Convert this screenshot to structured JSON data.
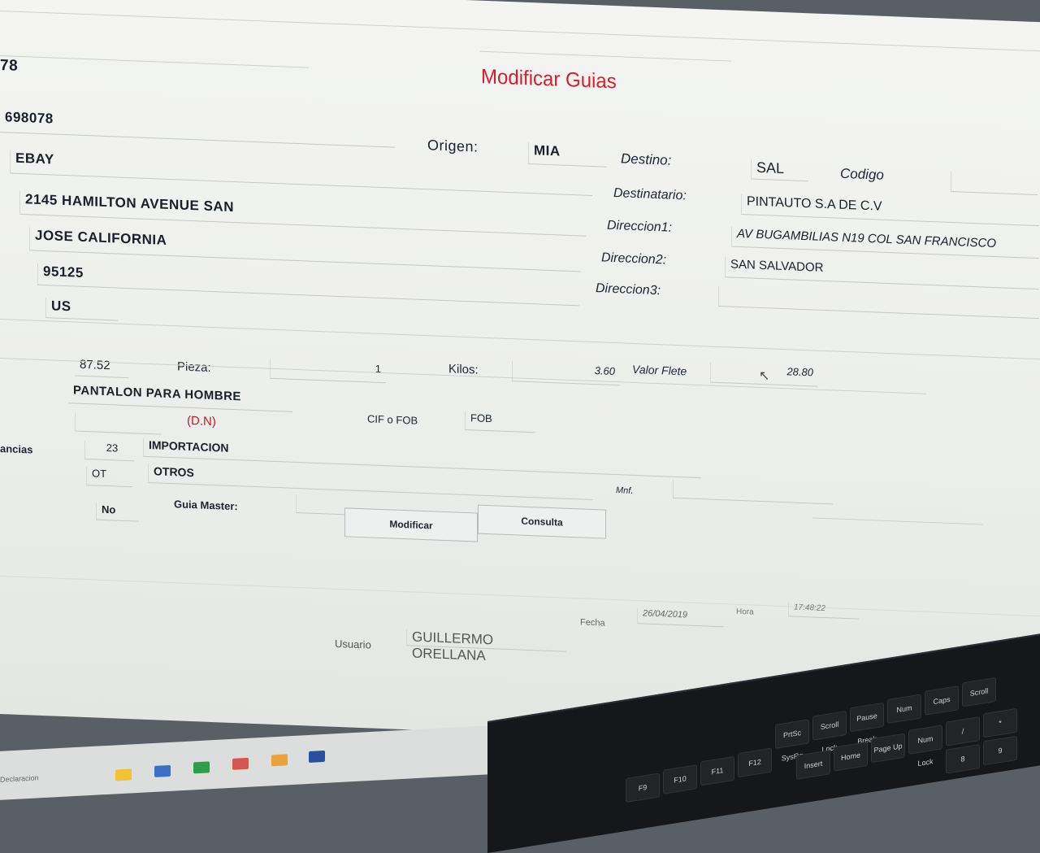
{
  "window": {
    "title": "Modificar Guias"
  },
  "header_left": {
    "fragment": "78",
    "guia_number": "698078"
  },
  "shipper": {
    "name": "EBAY",
    "address1": "2145 HAMILTON AVENUE SAN",
    "address2": "JOSE CALIFORNIA",
    "zip": "95125",
    "country": "US"
  },
  "route": {
    "origen_label": "Origen:",
    "origen_value": "MIA",
    "destino_label": "Destino:",
    "destino_value": "SAL",
    "codigo_label": "Codigo",
    "codigo_value": ""
  },
  "consignee": {
    "destinatario_label": "Destinatario:",
    "destinatario_value": "PINTAUTO S.A DE C.V",
    "direccion1_label": "Direccion1:",
    "direccion1_value": "AV BUGAMBILIAS N19 COL SAN FRANCISCO",
    "direccion2_label": "Direccion2:",
    "direccion2_value": "SAN SALVADOR",
    "direccion3_label": "Direccion3:",
    "direccion3_value": ""
  },
  "cargo": {
    "amount": "87.52",
    "pieza_label": "Pieza:",
    "pieza_value": "1",
    "kilos_label": "Kilos:",
    "kilos_value": "3.60",
    "valor_flete_label": "Valor Flete",
    "valor_flete_value": "28.80",
    "description": "PANTALON PARA HOMBRE",
    "dn_label": "(D.N)",
    "cif_fob_label": "CIF o FOB",
    "cif_fob_value": "FOB",
    "regimen_label": "ancias",
    "regimen_code": "23",
    "regimen_desc": "IMPORTACION",
    "tipo_code": "OT",
    "tipo_desc": "OTROS",
    "mnf_label": "Mnf.",
    "mnf_value": "",
    "master_flag": "No",
    "guia_master_label": "Guia Master:",
    "guia_master_value": ""
  },
  "buttons": {
    "modificar": "Modificar",
    "consulta": "Consulta"
  },
  "status_bar": {
    "usuario_label": "Usuario",
    "usuario_value": "GUILLERMO ORELLANA",
    "fecha_label": "Fecha",
    "fecha_value": "26/04/2019",
    "hora_label": "Hora",
    "hora_value": "17:48:22"
  },
  "taskbar": {
    "item_label": "Declaracion"
  },
  "keyboard": {
    "keys": [
      "F9",
      "F10",
      "F11",
      "F12",
      "PrtSc SysRq",
      "Scroll Lock",
      "Pause Break",
      "Num",
      "Caps",
      "Scroll",
      "Insert",
      "Home",
      "Page Up",
      "Num Lock",
      "/",
      "*",
      "8",
      "9"
    ]
  },
  "colors": {
    "title": "#d41f2b",
    "dn": "#c9171d",
    "bg": "#eceeec"
  }
}
